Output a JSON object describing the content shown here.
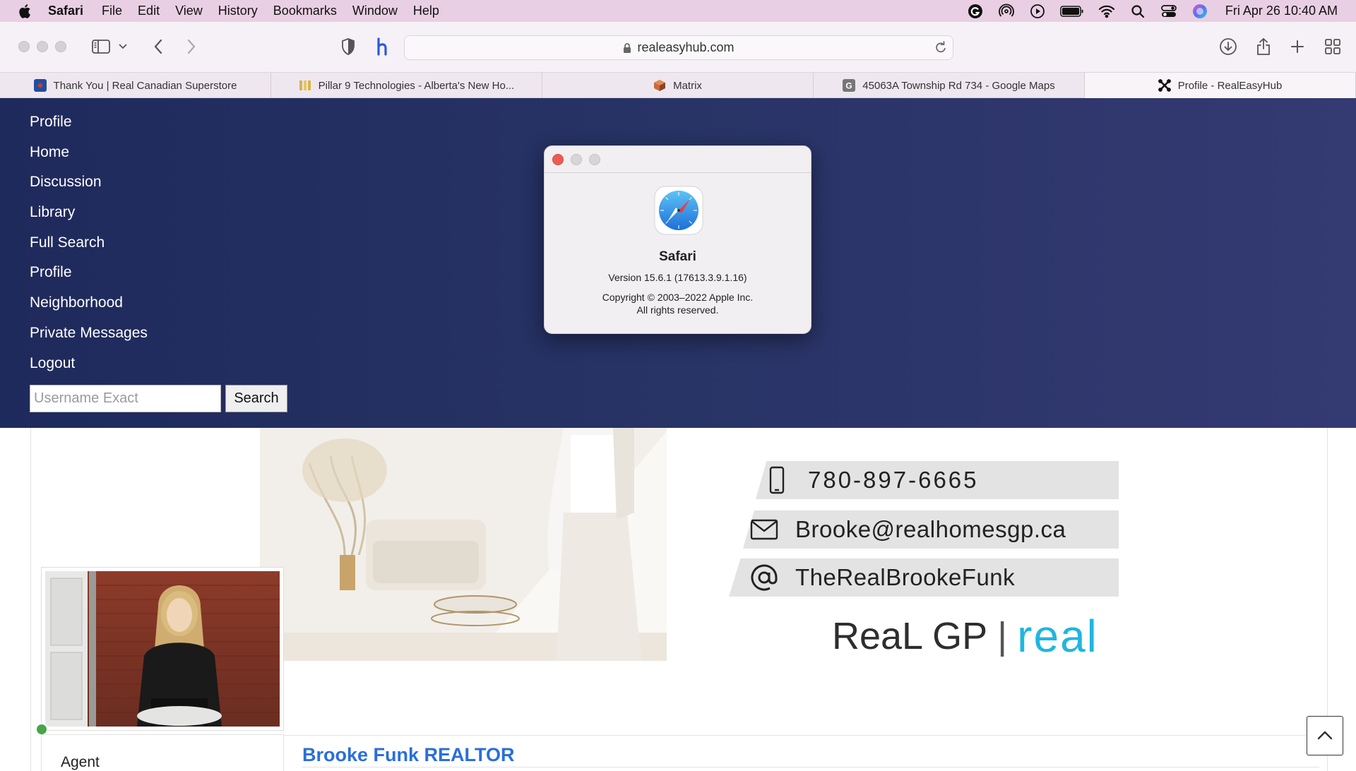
{
  "menubar": {
    "app_name": "Safari",
    "items": [
      "File",
      "Edit",
      "View",
      "History",
      "Bookmarks",
      "Window",
      "Help"
    ],
    "clock": "Fri Apr 26  10:40 AM"
  },
  "toolbar": {
    "url": "realeasyhub.com"
  },
  "tabs": [
    {
      "label": "Thank You | Real Canadian Superstore",
      "icon": "superstore-favicon"
    },
    {
      "label": "Pillar 9 Technologies - Alberta's New Ho...",
      "icon": "pillar9-favicon"
    },
    {
      "label": "Matrix",
      "icon": "matrix-favicon"
    },
    {
      "label": "45063A Township Rd 734 - Google Maps",
      "icon": "google-favicon"
    },
    {
      "label": "Profile - RealEasyHub",
      "icon": "joomla-favicon",
      "active": true
    }
  ],
  "nav": {
    "links": [
      "Profile",
      "Home",
      "Discussion",
      "Library",
      "Full Search",
      "Profile",
      "Neighborhood",
      "Private Messages",
      "Logout"
    ],
    "search_placeholder": "Username Exact",
    "search_button": "Search"
  },
  "banner": {
    "phone": "780-897-6665",
    "email": "Brooke@realhomesgp.ca",
    "handle": "TheRealBrookeFunk",
    "logo_left": "ReaL GP",
    "logo_sep": "|",
    "logo_right": "real"
  },
  "profile": {
    "role": "Agent",
    "name": "Brooke Funk REALTOR",
    "online_color": "#47a447"
  },
  "about_dialog": {
    "app_name": "Safari",
    "version": "Version 15.6.1 (17613.3.9.1.16)",
    "copyright": "Copyright © 2003–2022 Apple Inc.",
    "rights": "All rights reserved."
  },
  "colors": {
    "nav_bg": "#283366",
    "menubar_bg": "#e9cfe3",
    "link_blue": "#2a6edb"
  }
}
